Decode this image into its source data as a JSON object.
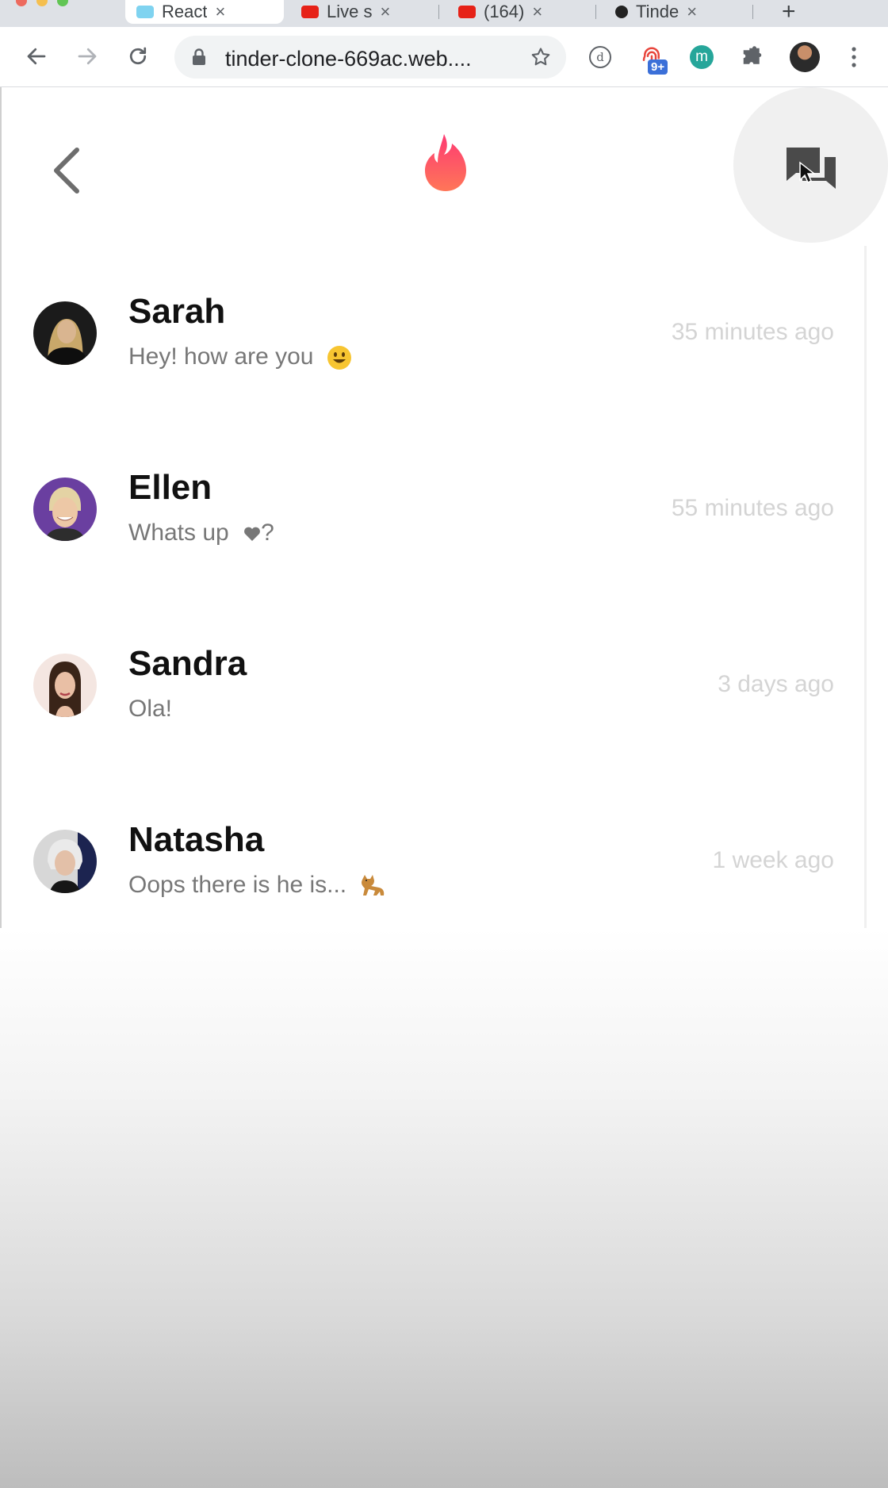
{
  "browser": {
    "tabs": [
      {
        "title": "React",
        "color": "#61dafb"
      },
      {
        "title": "Live s",
        "color": "#e62117"
      },
      {
        "title": "(164) ",
        "color": "#e62117"
      },
      {
        "title": "Tinde",
        "color": "#222222"
      }
    ],
    "tab_close": "×",
    "new_tab": "+",
    "url": "tinder-clone-669ac.web....",
    "extension_badge": "9+",
    "extension_d_letter": "d",
    "extension_m_letter": "m",
    "icons": {
      "back": "arrow-left-icon",
      "forward": "arrow-right-icon",
      "reload": "reload-icon",
      "lock": "lock-icon",
      "bookmark": "star-icon",
      "extensions": "puzzle-icon",
      "menu": "kebab-menu-icon"
    }
  },
  "app": {
    "brand_color": "#fd5068",
    "icons": {
      "back": "chevron-left-icon",
      "logo": "tinder-flame-icon",
      "chats": "chat-bubbles-icon"
    }
  },
  "chats": [
    {
      "name": "Sarah",
      "message": "Hey! how are you",
      "emoji": "smiley-emoji",
      "time": "35 minutes ago",
      "avatar_colors": [
        "#1b1b1b",
        "#c9a86a"
      ]
    },
    {
      "name": "Ellen",
      "message": "Whats up",
      "emoji": "heart-emoji",
      "message_suffix": "?",
      "time": "55 minutes ago",
      "avatar_colors": [
        "#6a3fa0",
        "#e8c8a8"
      ]
    },
    {
      "name": "Sandra",
      "message": "Ola!",
      "time": "3 days ago",
      "avatar_colors": [
        "#f4e6e1",
        "#3a2418"
      ]
    },
    {
      "name": "Natasha",
      "message": "Oops there is he is...",
      "emoji": "cat-emoji",
      "time": "1 week ago",
      "avatar_colors": [
        "#d7d7d7",
        "#1c2450"
      ]
    }
  ]
}
